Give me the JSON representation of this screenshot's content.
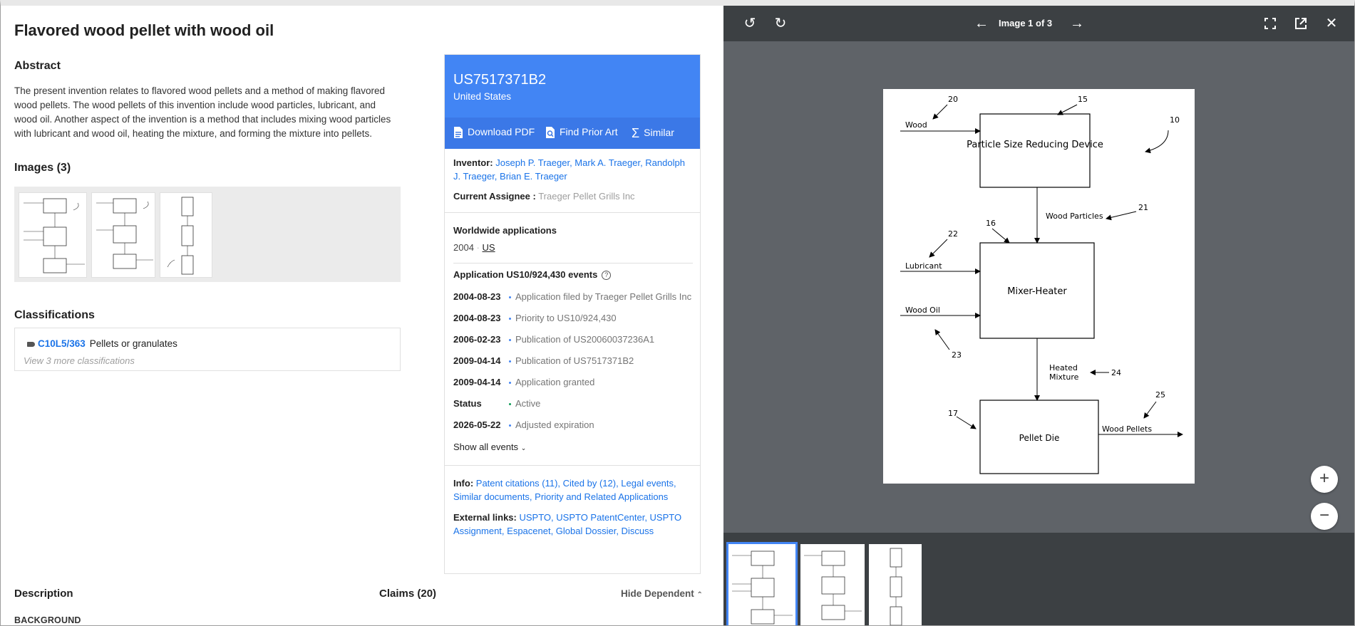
{
  "doc": {
    "title": "Flavored wood pellet with wood oil",
    "abstract_heading": "Abstract",
    "abstract": "The present invention relates to flavored wood pellets and a method of making flavored wood pellets. The wood pellets of this invention include wood particles, lubricant, and wood oil. Another aspect of the invention is a method that includes mixing wood particles with lubricant and wood oil, heating the mixture, and forming the mixture into pellets.",
    "images_heading": "Images (3)",
    "classifications_heading": "Classifications",
    "classification": {
      "code": "C10L5/363",
      "label": "Pellets or granulates"
    },
    "view_more": "View 3 more classifications",
    "description_heading": "Description",
    "claims_heading": "Claims (20)",
    "hide_dependent": "Hide Dependent",
    "background_heading": "BACKGROUND"
  },
  "card": {
    "pub_number": "US7517371B2",
    "country": "United States",
    "actions": {
      "download": "Download PDF",
      "prior_art": "Find Prior Art",
      "similar": "Similar"
    },
    "inventor_label": "Inventor:",
    "inventors": "Joseph P. Traeger, Mark A. Traeger, Randolph J. Traeger, Brian E. Traeger",
    "assignee_label": "Current Assignee :",
    "assignee": "Traeger Pellet Grills Inc",
    "worldwide_label": "Worldwide applications",
    "ww_year": "2004",
    "ww_country": "US",
    "events_heading": "Application US10/924,430 events",
    "events": [
      {
        "date": "2004-08-23",
        "text": "Application filed by Traeger Pellet Grills Inc"
      },
      {
        "date": "2004-08-23",
        "text": "Priority to US10/924,430"
      },
      {
        "date": "2006-02-23",
        "text": "Publication of US20060037236A1"
      },
      {
        "date": "2009-04-14",
        "text": "Publication of US7517371B2"
      },
      {
        "date": "2009-04-14",
        "text": "Application granted"
      },
      {
        "date": "Status",
        "text": "Active"
      },
      {
        "date": "2026-05-22",
        "text": "Adjusted expiration"
      }
    ],
    "show_all": "Show all events",
    "info_label": "Info:",
    "info_links": "Patent citations (11), Cited by (12), Legal events, Similar documents, Priority and Related Applications",
    "external_label": "External links:",
    "external_links": "USPTO, USPTO PatentCenter, USPTO Assignment, Espacenet, Global Dossier, Discuss"
  },
  "viewer": {
    "counter": "Image 1 of 3",
    "icons": [
      "rotate-left-icon",
      "rotate-right-icon",
      "arrow-left-icon",
      "arrow-right-icon",
      "fullscreen-icon",
      "open-new-icon",
      "close-icon",
      "zoom-in-icon",
      "zoom-out-icon"
    ],
    "figure": {
      "box1": "Particle Size Reducing Device",
      "box2": "Mixer-Heater",
      "box3": "Pellet Die",
      "wood": "Wood",
      "wood_particles": "Wood Particles",
      "lubricant": "Lubricant",
      "wood_oil": "Wood Oil",
      "heated_mixture_1": "Heated",
      "heated_mixture_2": "Mixture",
      "wood_pellets": "Wood Pellets",
      "refs": [
        "20",
        "15",
        "10",
        "21",
        "22",
        "16",
        "23",
        "24",
        "25",
        "17"
      ]
    }
  },
  "colors": {
    "accent": "#4285f4",
    "link": "#1a73e8",
    "viewer_bg": "#5f6368",
    "toolbar": "#3c4043"
  }
}
